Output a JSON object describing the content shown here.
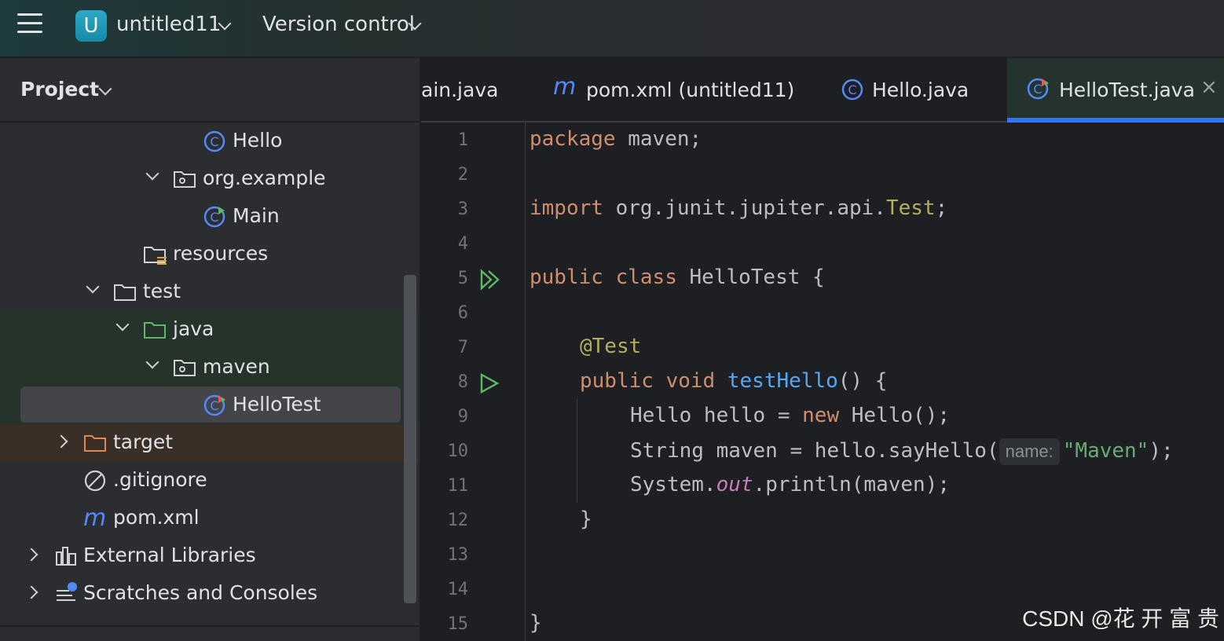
{
  "topbar": {
    "project_badge": "U",
    "project_name": "untitled11",
    "vcs_label": "Version control"
  },
  "sidebar": {
    "title": "Project",
    "tree": [
      {
        "label": "Hello",
        "icon": "class-icon",
        "expanded": null
      },
      {
        "label": "org.example",
        "icon": "package-folder-icon",
        "expanded": true
      },
      {
        "label": "Main",
        "icon": "runnable-class-icon",
        "expanded": null
      },
      {
        "label": "resources",
        "icon": "resources-folder-icon",
        "expanded": null
      },
      {
        "label": "test",
        "icon": "folder-icon",
        "expanded": true
      },
      {
        "label": "java",
        "icon": "test-source-folder-icon",
        "expanded": true
      },
      {
        "label": "maven",
        "icon": "package-folder-icon",
        "expanded": true
      },
      {
        "label": "HelloTest",
        "icon": "test-class-icon",
        "expanded": null,
        "selected": true
      },
      {
        "label": "target",
        "icon": "excluded-folder-icon",
        "expanded": false
      },
      {
        "label": ".gitignore",
        "icon": "ignore-file-icon",
        "expanded": null
      },
      {
        "label": "pom.xml",
        "icon": "maven-icon",
        "expanded": null
      },
      {
        "label": "External Libraries",
        "icon": "library-icon",
        "expanded": false
      },
      {
        "label": "Scratches and Consoles",
        "icon": "scratches-icon",
        "expanded": false
      }
    ]
  },
  "tabs": [
    {
      "label": "ain.java",
      "icon": "none"
    },
    {
      "label": "pom.xml (untitled11)",
      "icon": "maven-icon"
    },
    {
      "label": "Hello.java",
      "icon": "class-icon"
    },
    {
      "label": "HelloTest.java",
      "icon": "test-class-icon",
      "active": true,
      "close": "×"
    }
  ],
  "editor": {
    "line_numbers": [
      "1",
      "2",
      "3",
      "4",
      "5",
      "6",
      "7",
      "8",
      "9",
      "10",
      "11",
      "12",
      "13",
      "14",
      "15"
    ],
    "code": {
      "l1_kw": "package",
      "l1_rest": " maven;",
      "l3_kw": "import",
      "l3_mid": " org.junit.jupiter.api.",
      "l3_ann": "Test",
      "l3_end": ";",
      "l5_kw1": "public",
      "l5_kw2": "class",
      "l5_rest": " HelloTest {",
      "l7_ann": "@Test",
      "l8_kw1": "public",
      "l8_kw2": "void",
      "l8_fn": "testHello",
      "l8_rest": "() {",
      "l9_a": "Hello hello = ",
      "l9_kw": "new",
      "l9_b": " Hello();",
      "l10_a": "String maven = hello.sayHello(",
      "l10_hint": "name:",
      "l10_str": "\"Maven\"",
      "l10_b": ");",
      "l11_a": "System.",
      "l11_fld": "out",
      "l11_b": ".println(maven);",
      "l12": "}",
      "l15": "}"
    }
  },
  "watermark": "CSDN @花 开 富 贵",
  "colors": {
    "accent": "#3574f0",
    "keyword": "#cf8e6d",
    "string": "#6aab73",
    "function": "#56a8f5"
  }
}
